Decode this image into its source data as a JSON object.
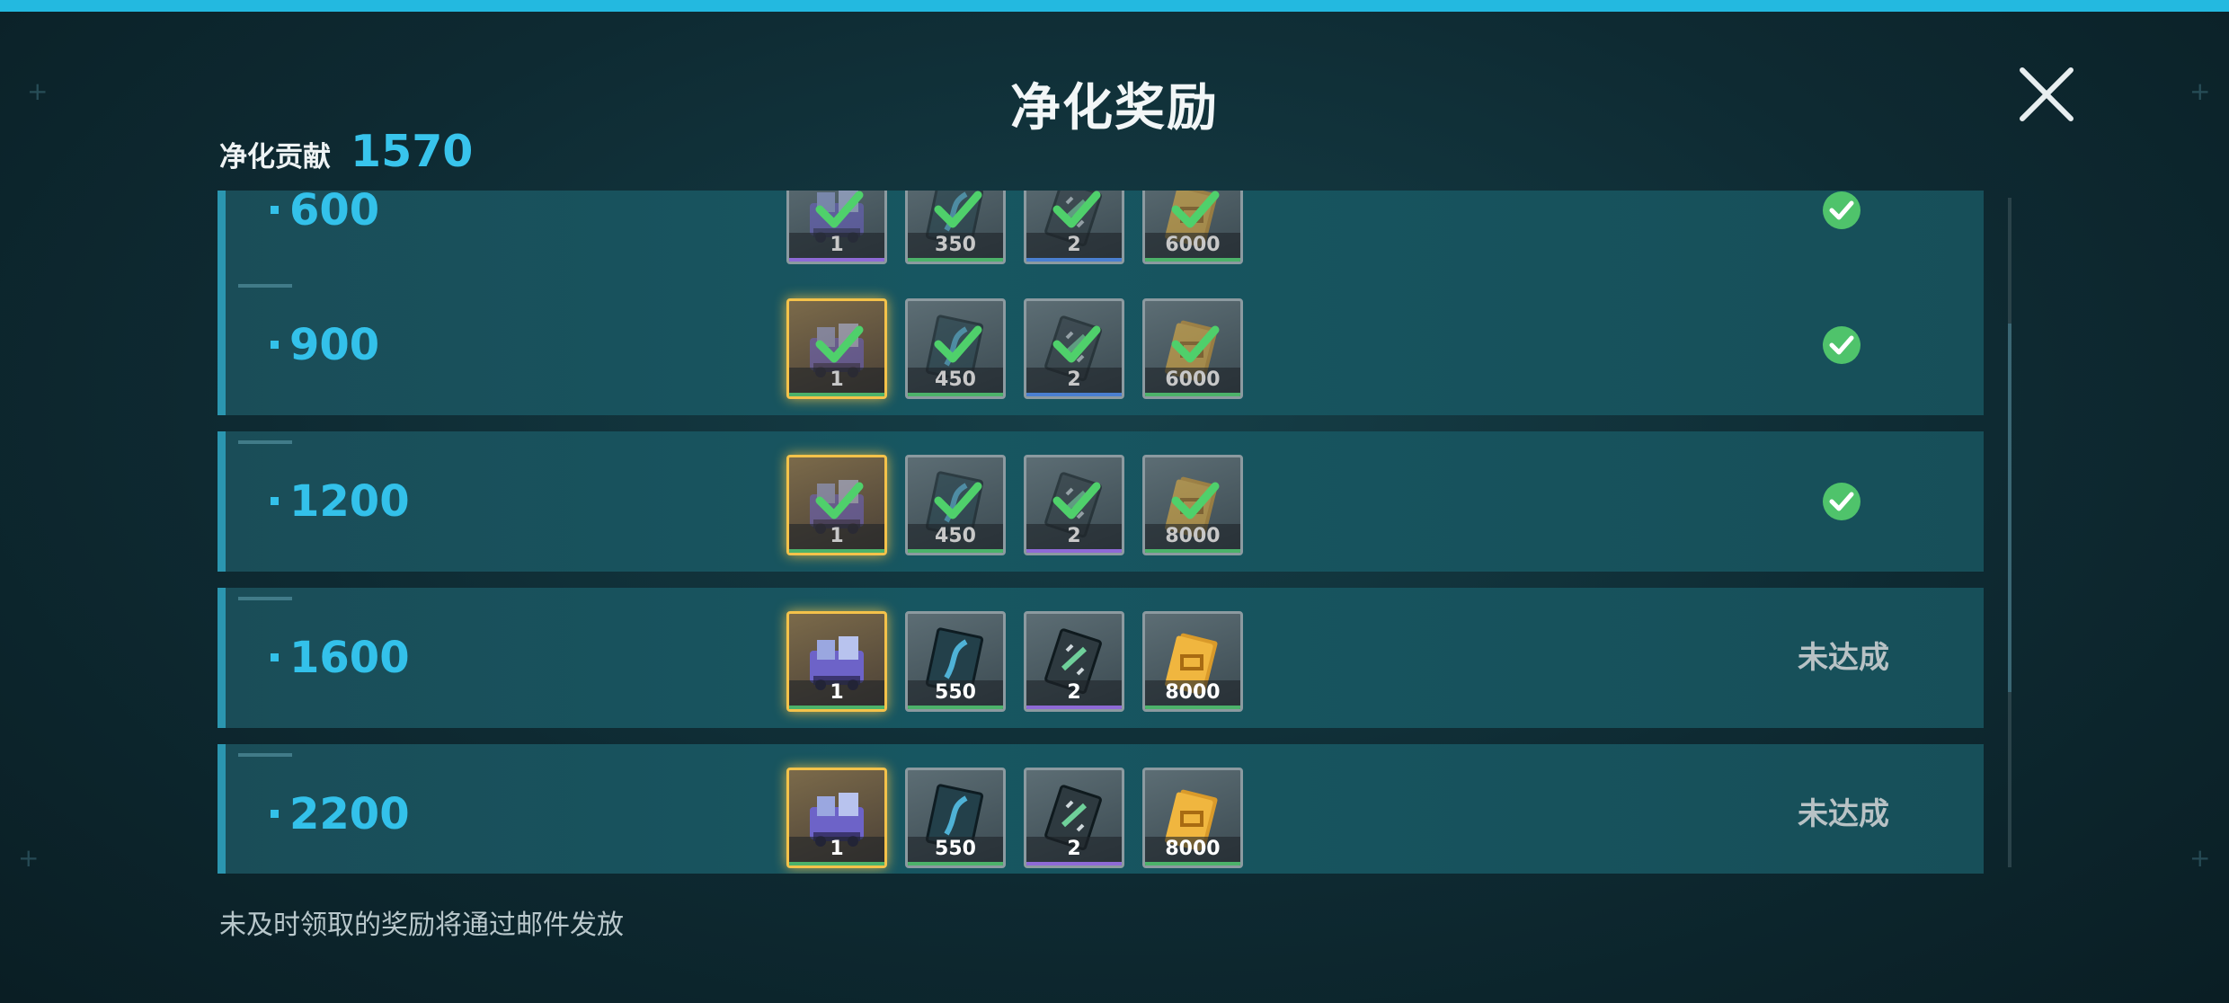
{
  "title": "净化奖励",
  "contribution": {
    "label": "净化贡献",
    "value": "1570"
  },
  "footnote": "未及时领取的奖励将通过邮件发放",
  "colors": {
    "accent": "#33c1ea",
    "claimed_check": "#4fc36b",
    "top_bar": "#23b9e0"
  },
  "tiers": [
    {
      "threshold": "600",
      "status": "claimed",
      "status_text": "",
      "items": [
        {
          "icon": "mech-unit-icon",
          "count": "1",
          "rarity": "purple"
        },
        {
          "icon": "blueprint-icon",
          "count": "350",
          "rarity": "green"
        },
        {
          "icon": "ticket-icon",
          "count": "2",
          "rarity": "blue"
        },
        {
          "icon": "gold-bar-icon",
          "count": "6000",
          "rarity": "green"
        }
      ]
    },
    {
      "threshold": "900",
      "status": "claimed",
      "status_text": "",
      "items": [
        {
          "icon": "mech-unit-icon",
          "count": "1",
          "rarity": "gold"
        },
        {
          "icon": "blueprint-icon",
          "count": "450",
          "rarity": "green"
        },
        {
          "icon": "ticket-icon",
          "count": "2",
          "rarity": "blue"
        },
        {
          "icon": "gold-bar-icon",
          "count": "6000",
          "rarity": "green"
        }
      ]
    },
    {
      "threshold": "1200",
      "status": "claimed",
      "status_text": "",
      "items": [
        {
          "icon": "mech-unit-icon",
          "count": "1",
          "rarity": "gold"
        },
        {
          "icon": "blueprint-icon",
          "count": "450",
          "rarity": "green"
        },
        {
          "icon": "ticket-icon",
          "count": "2",
          "rarity": "purple"
        },
        {
          "icon": "gold-bar-icon",
          "count": "8000",
          "rarity": "green"
        }
      ]
    },
    {
      "threshold": "1600",
      "status": "locked",
      "status_text": "未达成",
      "items": [
        {
          "icon": "mech-unit-icon",
          "count": "1",
          "rarity": "gold"
        },
        {
          "icon": "blueprint-icon",
          "count": "550",
          "rarity": "green"
        },
        {
          "icon": "ticket-icon",
          "count": "2",
          "rarity": "purple"
        },
        {
          "icon": "gold-bar-icon",
          "count": "8000",
          "rarity": "green"
        }
      ]
    },
    {
      "threshold": "2200",
      "status": "locked",
      "status_text": "未达成",
      "items": [
        {
          "icon": "mech-unit-icon",
          "count": "1",
          "rarity": "gold"
        },
        {
          "icon": "blueprint-icon",
          "count": "550",
          "rarity": "green"
        },
        {
          "icon": "ticket-icon",
          "count": "2",
          "rarity": "purple"
        },
        {
          "icon": "gold-bar-icon",
          "count": "8000",
          "rarity": "green"
        }
      ]
    }
  ]
}
